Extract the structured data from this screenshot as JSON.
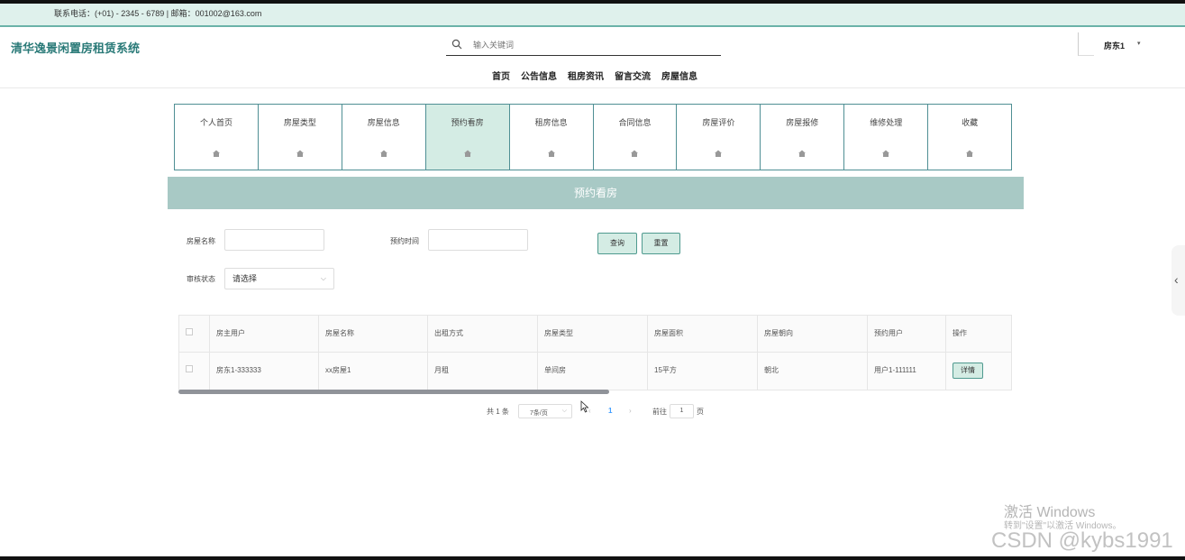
{
  "top_info": "联系电话：(+01) - 2345 - 6789 | 邮箱：001002@163.com",
  "header": {
    "logo": "清华逸景闲置房租赁系统",
    "search_placeholder": "输入关键词",
    "nav": [
      "首页",
      "公告信息",
      "租房资讯",
      "留言交流",
      "房屋信息"
    ],
    "user_name": "房东1",
    "user_caret": "▾"
  },
  "tabs": [
    {
      "label": "个人首页",
      "active": false
    },
    {
      "label": "房屋类型",
      "active": false
    },
    {
      "label": "房屋信息",
      "active": false
    },
    {
      "label": "预约看房",
      "active": true
    },
    {
      "label": "租房信息",
      "active": false
    },
    {
      "label": "合同信息",
      "active": false
    },
    {
      "label": "房屋评价",
      "active": false
    },
    {
      "label": "房屋报修",
      "active": false
    },
    {
      "label": "维修处理",
      "active": false
    },
    {
      "label": "收藏",
      "active": false
    }
  ],
  "banner": "预约看房",
  "filters": {
    "house_name_label": "房屋名称",
    "house_name_value": "",
    "booking_time_label": "预约时间",
    "booking_time_value": "",
    "audit_status_label": "审核状态",
    "audit_status_value": "请选择",
    "query_button": "查询",
    "reset_button": "重置"
  },
  "table": {
    "headers": [
      "房主用户",
      "房屋名称",
      "出租方式",
      "房屋类型",
      "房屋面积",
      "房屋朝向",
      "预约用户",
      "操作"
    ],
    "rows": [
      [
        "房东1-333333",
        "xx房屋1",
        "月租",
        "单间房",
        "15平方",
        "朝北",
        "用户1-111111"
      ]
    ],
    "detail_button": "详情"
  },
  "pagination": {
    "total": "共 1 条",
    "page_size": "7条/页",
    "current_page": "1",
    "goto_label": "前往",
    "goto_value": "1",
    "page_unit": "页"
  },
  "watermark": {
    "line1": "激活 Windows",
    "line2": "转到\"设置\"以激活 Windows。",
    "line3": "CSDN @kybs1991"
  },
  "colors": {
    "accent": "#2a7a78",
    "tab_border": "#4f8f94",
    "active_tab_bg": "#d4ece4",
    "banner_bg": "#a8c9c5",
    "infobar_bg": "#dff1ec"
  }
}
